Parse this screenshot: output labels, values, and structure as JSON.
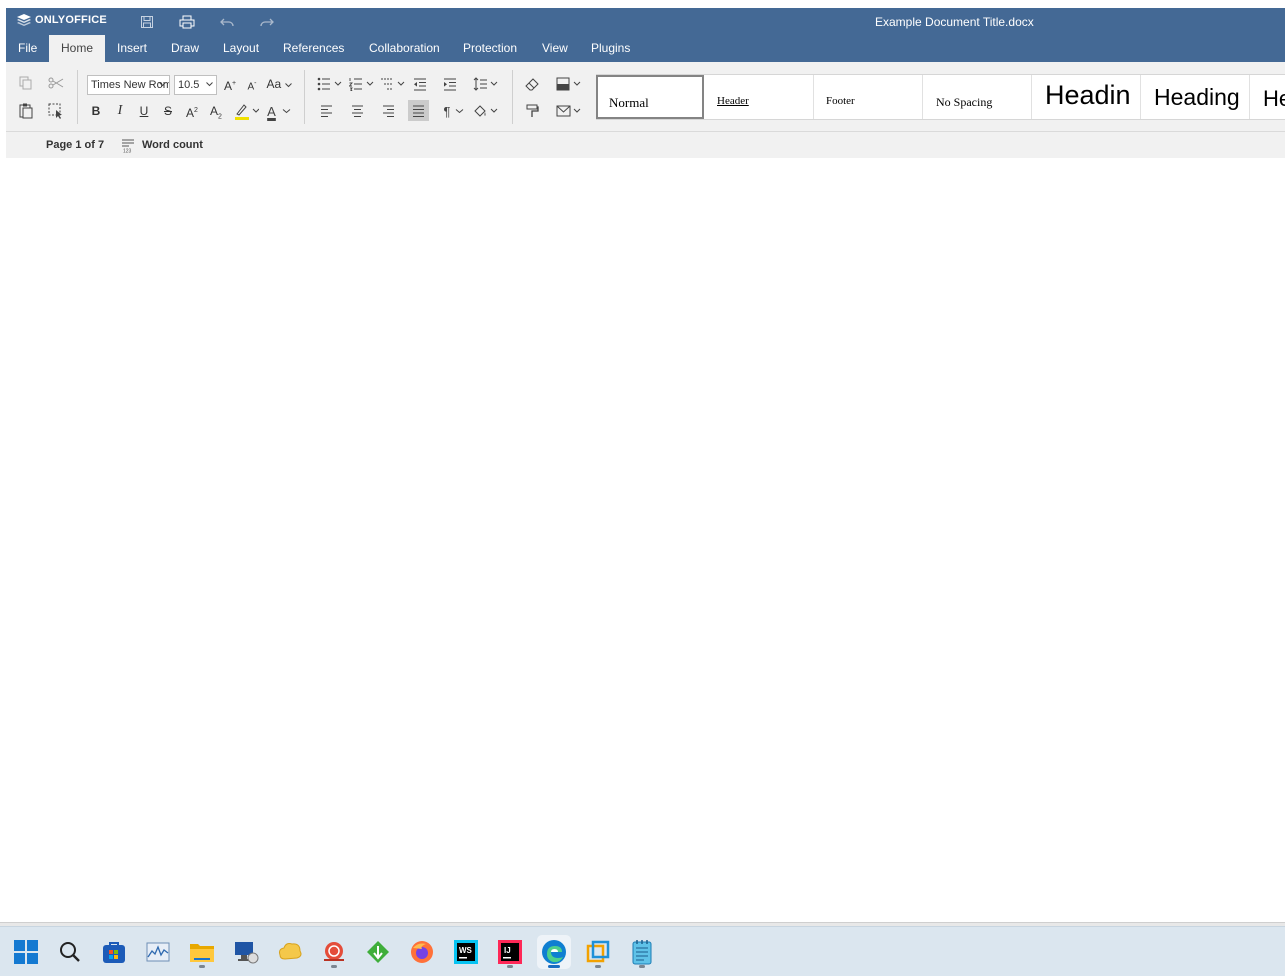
{
  "app": {
    "brand": "ONLYOFFICE",
    "document_title": "Example Document Title.docx"
  },
  "menu": {
    "tabs": [
      "File",
      "Home",
      "Insert",
      "Draw",
      "Layout",
      "References",
      "Collaboration",
      "Protection",
      "View",
      "Plugins"
    ],
    "active": "Home"
  },
  "toolbar": {
    "font_name": "Times New Roman",
    "font_size": "10.5",
    "change_case_label": "Aa",
    "increase_font_label": "A",
    "decrease_font_label": "A",
    "bold_label": "B",
    "italic_label": "I",
    "underline_label": "U",
    "strike_label": "S",
    "superscript_label": "A",
    "subscript_label": "A",
    "font_color_label": "A",
    "pilcrow_label": "¶",
    "highlight_color": "#f0e000",
    "font_color": "#000000"
  },
  "styles": {
    "items": [
      "Normal",
      "Header",
      "Footer",
      "No Spacing",
      "Headin",
      "Heading",
      "He"
    ],
    "selected": "Normal"
  },
  "statusbar": {
    "page_info": "Page 1 of 7",
    "word_count_label": "Word count"
  },
  "taskbar": {
    "apps": [
      "start",
      "search",
      "store",
      "resource-monitor",
      "file-explorer",
      "remote-desktop",
      "cloud-app",
      "snail-app",
      "git-app",
      "firefox",
      "webstorm",
      "intellij",
      "edge",
      "vm-app",
      "notepad"
    ],
    "active": "edge",
    "accent": "#1b6dc1"
  },
  "colors": {
    "header_bg": "#446995",
    "toolbar_bg": "#f1f1f1"
  }
}
